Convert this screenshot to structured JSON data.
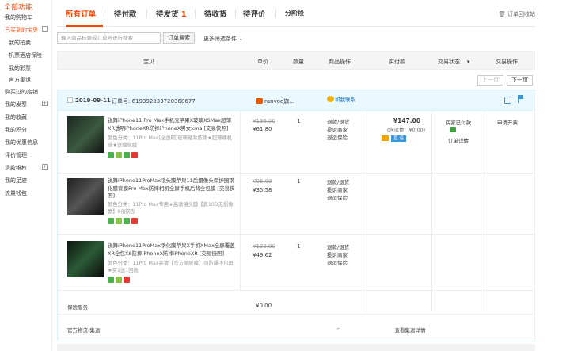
{
  "sidebar": {
    "all_label": "全部功能",
    "items": [
      {
        "label": "我的购物车",
        "sub": false,
        "active": false,
        "toggle": ""
      },
      {
        "label": "已买到的宝贝",
        "sub": false,
        "active": true,
        "toggle": "-"
      },
      {
        "label": "我的拍卖",
        "sub": true,
        "active": false,
        "toggle": ""
      },
      {
        "label": "机票酒店保险",
        "sub": true,
        "active": false,
        "toggle": ""
      },
      {
        "label": "我的彩票",
        "sub": true,
        "active": false,
        "toggle": ""
      },
      {
        "label": "官方集运",
        "sub": true,
        "active": false,
        "toggle": ""
      },
      {
        "label": "购买过的店铺",
        "sub": false,
        "active": false,
        "toggle": ""
      },
      {
        "label": "我的发票",
        "sub": false,
        "active": false,
        "toggle": "+"
      },
      {
        "label": "我的收藏",
        "sub": false,
        "active": false,
        "toggle": ""
      },
      {
        "label": "我的积分",
        "sub": false,
        "active": false,
        "toggle": ""
      },
      {
        "label": "我的优惠信息",
        "sub": false,
        "active": false,
        "toggle": ""
      },
      {
        "label": "评价管理",
        "sub": false,
        "active": false,
        "toggle": ""
      },
      {
        "label": "退款维权",
        "sub": false,
        "active": false,
        "toggle": "+"
      },
      {
        "label": "我的足迹",
        "sub": false,
        "active": false,
        "toggle": ""
      },
      {
        "label": "流量钱包",
        "sub": false,
        "active": false,
        "toggle": ""
      }
    ]
  },
  "tabs": [
    {
      "label": "所有订单",
      "count": "",
      "active": true
    },
    {
      "label": "待付款",
      "count": "",
      "active": false
    },
    {
      "label": "待发货",
      "count": "1",
      "active": false
    },
    {
      "label": "待收货",
      "count": "",
      "active": false
    },
    {
      "label": "待评价",
      "count": "",
      "active": false
    },
    {
      "label": "分阶段",
      "count": "",
      "active": false
    }
  ],
  "recycle_label": "订单回收站",
  "search": {
    "placeholder": "输入商品标题或订单号进行搜索",
    "button": "订单搜索",
    "more": "更多筛选条件"
  },
  "table_header": {
    "item": "宝贝",
    "price": "单价",
    "qty": "数量",
    "ops": "商品操作",
    "paid": "实付款",
    "status": "交易状态",
    "actions": "交易操作"
  },
  "pager": {
    "prev": "上一页",
    "next": "下一页"
  },
  "order": {
    "date": "2019-09-11",
    "order_no_label": "订单号: 619392833720368677",
    "shop": "ranvoo旗...",
    "contact": "和我联系",
    "total": "¥147.00",
    "shipping": "(含运费：¥0.00)",
    "pay_badge": "直 运",
    "status": "买家已付款",
    "status_detail": "订单详情",
    "apply": "申请开票",
    "items": [
      {
        "title": "锐舞iPhone11 Pro Max手机壳苹果X玻璃XSMax超薄XR透明iPhoneXR防摔iPhoneX男女xma [交易快照]",
        "attrs": "颜色分类：11Pro Max[全透明]玻璃硬背防摔★超薄裸机感★送膜化膜",
        "orig_price": "¥136.00",
        "price": "¥61.80",
        "qty": "1",
        "ops": [
          "退款/退货",
          "投诉商家",
          "退运保险"
        ]
      },
      {
        "title": "锐舞iPhone11ProMax镜头膜苹果11后摄像头保护圈钢化膜背膜Pro Max防摔相机全屏手机后背全包膜 [交易快照]",
        "attrs": "颜色分类：11Pro Max专用★高清镜头膜【真10D无损像素】8倍防刮",
        "orig_price": "¥96.00",
        "price": "¥35.58",
        "qty": "1",
        "ops": [
          "退款/退货",
          "投诉商家",
          "退运保险"
        ]
      },
      {
        "title": "锐舞iPhone11ProMax钢化膜苹果X手机XMax全屏覆盖XR全包XS防摔iPhoneX防摔iPhoneXR [交易快照]",
        "attrs": "颜色分类：11Pro Max高清【官方原配膜】强防爆不包屏★买1送1回数",
        "orig_price": "¥138.00",
        "price": "¥49.62",
        "qty": "1",
        "ops": [
          "退款/退货",
          "投诉商家",
          "退运保险"
        ]
      }
    ],
    "insurance_label": "保险服务",
    "insurance_price": "¥0.00",
    "logistics_label": "官方物流-集运",
    "logistics_dash": "-",
    "logistics_view": "查看集运详情"
  },
  "colors": {
    "accent": "#ff4400",
    "blue": "#3a95d9",
    "header_bg": "#eaf8ff"
  }
}
